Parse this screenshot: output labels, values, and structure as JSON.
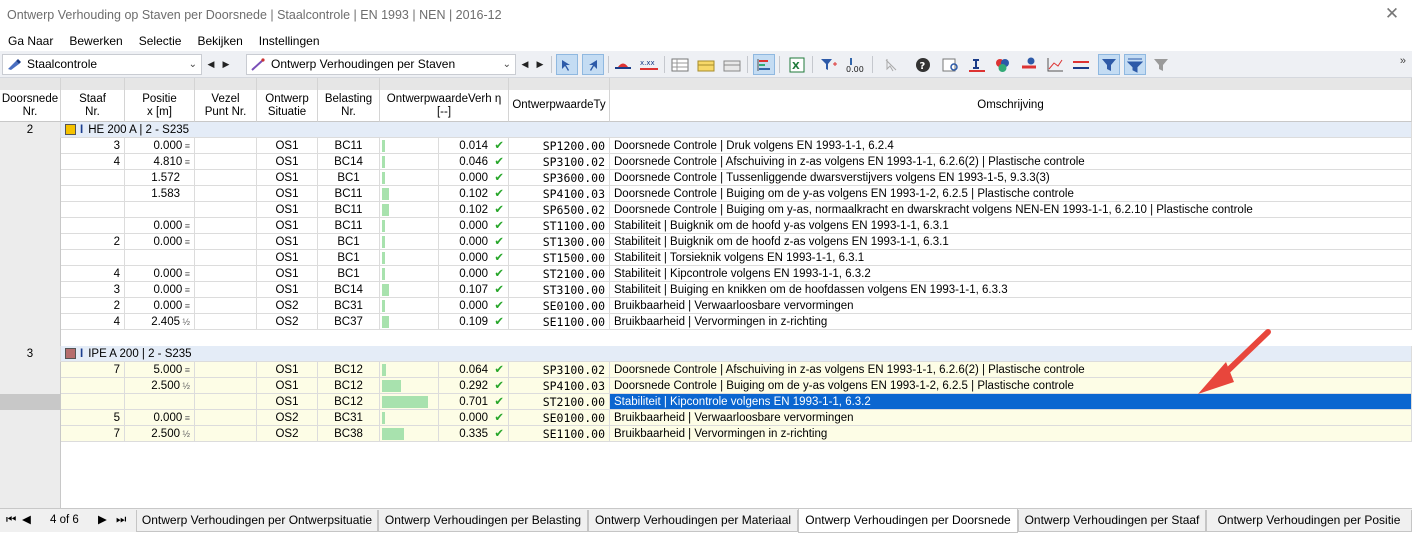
{
  "title": "Ontwerp Verhouding op Staven per Doorsnede | Staalcontrole | EN 1993 | NEN | 2016-12",
  "menu": [
    "Ga Naar",
    "Bewerken",
    "Selectie",
    "Bekijken",
    "Instellingen"
  ],
  "toolbar": {
    "combo1": "Staalcontrole",
    "combo2": "Ontwerp Verhoudingen per Staven"
  },
  "columns": {
    "c0": "Doorsnede\nNr.",
    "c1": "Staaf\nNr.",
    "c2": "Positie\nx [m]",
    "c3": "Vezel\nPunt Nr.",
    "c4": "Ontwerp\nSituatie",
    "c5": "Belasting\nNr.",
    "c6": "OntwerpwaardeVerh η\n[--]",
    "c7": "OntwerpwaardeTy",
    "c8": "Omschrijving"
  },
  "groups": [
    {
      "nr": "2",
      "section": "HE 200 A | 2 - S235",
      "color": "#f5c200",
      "rows": [
        {
          "staaf": "3",
          "pos": "0.000",
          "pm": "≡",
          "sit": "OS1",
          "bel": "BC11",
          "ratio": 0.014,
          "ratio_txt": "0.014",
          "type": "SP1200.00",
          "desc": "Doorsnede Controle | Druk volgens EN 1993-1-1, 6.2.4"
        },
        {
          "staaf": "4",
          "pos": "4.810",
          "pm": "≡",
          "sit": "OS1",
          "bel": "BC14",
          "ratio": 0.046,
          "ratio_txt": "0.046",
          "type": "SP3100.02",
          "desc": "Doorsnede Controle | Afschuiving in z-as volgens EN 1993-1-1, 6.2.6(2) | Plastische controle"
        },
        {
          "staaf": "",
          "pos": "1.572",
          "pm": "",
          "sit": "OS1",
          "bel": "BC1",
          "ratio": 0.0,
          "ratio_txt": "0.000",
          "type": "SP3600.00",
          "desc": "Doorsnede Controle | Tussenliggende dwarsverstijvers volgens EN 1993-1-5, 9.3.3(3)"
        },
        {
          "staaf": "",
          "pos": "1.583",
          "pm": "",
          "sit": "OS1",
          "bel": "BC11",
          "ratio": 0.102,
          "ratio_txt": "0.102",
          "type": "SP4100.03",
          "desc": "Doorsnede Controle | Buiging om de y-as volgens EN 1993-1-2, 6.2.5 | Plastische controle"
        },
        {
          "staaf": "",
          "pos": "",
          "pm": "",
          "sit": "OS1",
          "bel": "BC11",
          "ratio": 0.102,
          "ratio_txt": "0.102",
          "type": "SP6500.02",
          "desc": "Doorsnede Controle | Buiging om y-as, normaalkracht en dwarskracht volgens NEN-EN 1993-1-1, 6.2.10 | Plastische controle"
        },
        {
          "staaf": "",
          "pos": "0.000",
          "pm": "≡",
          "sit": "OS1",
          "bel": "BC11",
          "ratio": 0.0,
          "ratio_txt": "0.000",
          "type": "ST1100.00",
          "desc": "Stabiliteit | Buigknik om de hoofd y-as volgens EN 1993-1-1, 6.3.1"
        },
        {
          "staaf": "2",
          "pos": "0.000",
          "pm": "≡",
          "sit": "OS1",
          "bel": "BC1",
          "ratio": 0.0,
          "ratio_txt": "0.000",
          "type": "ST1300.00",
          "desc": "Stabiliteit | Buigknik om de hoofd z-as volgens EN 1993-1-1, 6.3.1"
        },
        {
          "staaf": "",
          "pos": "",
          "pm": "",
          "sit": "OS1",
          "bel": "BC1",
          "ratio": 0.0,
          "ratio_txt": "0.000",
          "type": "ST1500.00",
          "desc": "Stabiliteit | Torsieknik volgens EN 1993-1-1, 6.3.1"
        },
        {
          "staaf": "4",
          "pos": "0.000",
          "pm": "≡",
          "sit": "OS1",
          "bel": "BC1",
          "ratio": 0.0,
          "ratio_txt": "0.000",
          "type": "ST2100.00",
          "desc": "Stabiliteit | Kipcontrole volgens EN 1993-1-1, 6.3.2"
        },
        {
          "staaf": "3",
          "pos": "0.000",
          "pm": "≡",
          "sit": "OS1",
          "bel": "BC14",
          "ratio": 0.107,
          "ratio_txt": "0.107",
          "type": "ST3100.00",
          "desc": "Stabiliteit | Buiging en knikken om de hoofdassen volgens EN 1993-1-1, 6.3.3"
        },
        {
          "staaf": "2",
          "pos": "0.000",
          "pm": "≡",
          "sit": "OS2",
          "bel": "BC31",
          "ratio": 0.0,
          "ratio_txt": "0.000",
          "type": "SE0100.00",
          "desc": "Bruikbaarheid | Verwaarloosbare vervormingen"
        },
        {
          "staaf": "4",
          "pos": "2.405",
          "pm": "½",
          "sit": "OS2",
          "bel": "BC37",
          "ratio": 0.109,
          "ratio_txt": "0.109",
          "type": "SE1100.00",
          "desc": "Bruikbaarheid | Vervormingen in z-richting"
        }
      ]
    },
    {
      "nr": "3",
      "section": "IPE A 200 | 2 - S235",
      "color": "#b56d6d",
      "rows": [
        {
          "staaf": "7",
          "pos": "5.000",
          "pm": "≡",
          "sit": "OS1",
          "bel": "BC12",
          "ratio": 0.064,
          "ratio_txt": "0.064",
          "type": "SP3100.02",
          "desc": "Doorsnede Controle | Afschuiving in z-as volgens EN 1993-1-1, 6.2.6(2) | Plastische controle"
        },
        {
          "staaf": "",
          "pos": "2.500",
          "pm": "½",
          "sit": "OS1",
          "bel": "BC12",
          "ratio": 0.292,
          "ratio_txt": "0.292",
          "type": "SP4100.03",
          "desc": "Doorsnede Controle | Buiging om de y-as volgens EN 1993-1-2, 6.2.5 | Plastische controle"
        },
        {
          "staaf": "",
          "pos": "",
          "pm": "",
          "sit": "OS1",
          "bel": "BC12",
          "ratio": 0.701,
          "ratio_txt": "0.701",
          "type": "ST2100.00",
          "desc": "Stabiliteit | Kipcontrole volgens EN 1993-1-1, 6.3.2",
          "selected": true
        },
        {
          "staaf": "5",
          "pos": "0.000",
          "pm": "≡",
          "sit": "OS2",
          "bel": "BC31",
          "ratio": 0.0,
          "ratio_txt": "0.000",
          "type": "SE0100.00",
          "desc": "Bruikbaarheid | Verwaarloosbare vervormingen"
        },
        {
          "staaf": "7",
          "pos": "2.500",
          "pm": "½",
          "sit": "OS2",
          "bel": "BC38",
          "ratio": 0.335,
          "ratio_txt": "0.335",
          "type": "SE1100.00",
          "desc": "Bruikbaarheid | Vervormingen in z-richting"
        }
      ]
    }
  ],
  "pager": {
    "text": "4 of 6"
  },
  "tabs": [
    "Ontwerp Verhoudingen per Ontwerpsituatie",
    "Ontwerp Verhoudingen per Belasting",
    "Ontwerp Verhoudingen per Materiaal",
    "Ontwerp Verhoudingen per Doorsnede",
    "Ontwerp Verhoudingen per Staaf",
    "Ontwerp Verhoudingen per Positie"
  ],
  "active_tab": 3,
  "colors": {
    "group_header_bg": "#e4ecf7",
    "group3_row_bg": "#fdfde6",
    "selection": "#0b66d0",
    "bar": "#a8e2ae",
    "check": "#27a62a",
    "arrow": "#e8463c"
  }
}
